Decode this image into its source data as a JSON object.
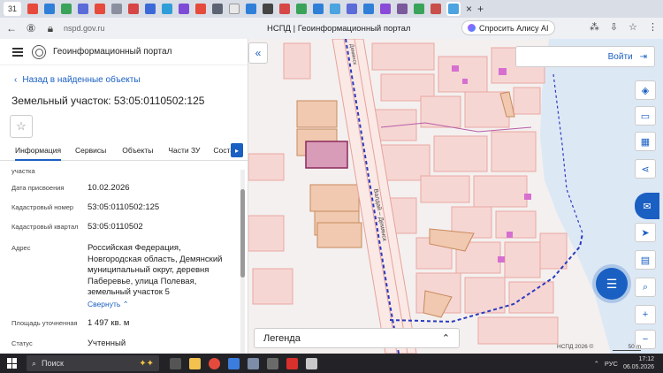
{
  "browser": {
    "tab_counter": "31",
    "url": "nspd.gov.ru",
    "page_title": "НСПД | Геоинформационный портал",
    "alice_label": "Спросить Алису AI"
  },
  "header": {
    "portal_title": "Геоинформационный портал"
  },
  "panel": {
    "back_label": "Назад в найденные объекты",
    "title": "Земельный участок: 53:05:0110502:125",
    "tabs": [
      "Информация",
      "Сервисы",
      "Объекты",
      "Части ЗУ",
      "Состав"
    ],
    "fields": [
      {
        "label": "участка",
        "value": ""
      },
      {
        "label": "Дата присвоения",
        "value": "10.02.2026"
      },
      {
        "label": "Кадастровый номер",
        "value": "53:05:0110502:125"
      },
      {
        "label": "Кадастровый квартал",
        "value": "53:05:0110502"
      },
      {
        "label": "Адрес",
        "value": "Российская Федерация, Новгородская область, Демянский муниципальный округ, деревня Паберевье, улица Полевая, земельный участок 5"
      },
      {
        "label": "Площадь уточненная",
        "value": "1 497 кв. м"
      },
      {
        "label": "Статус",
        "value": "Учтенный"
      }
    ],
    "collapse_label": "Свернуть"
  },
  "map": {
    "login_label": "Войти",
    "legend_label": "Легенда",
    "copyright": "НСПД 2026 ©",
    "scale": "50 m",
    "road_label_1": "Валдай – Демянск",
    "road_label_2": "Демянск"
  },
  "taskbar": {
    "search_placeholder": "Поиск",
    "lang": "РУС",
    "time": "17:12",
    "date": "06.05.2026"
  },
  "colors": {
    "accent": "#1a5fc2",
    "parcel_fill": "#f6d6d3",
    "parcel_stroke": "#e8a8a3",
    "selected_parcel": "#d89bb8",
    "building_fill": "#f0c9b0",
    "water": "#dde8f5",
    "boundary": "#2a3bbf"
  }
}
